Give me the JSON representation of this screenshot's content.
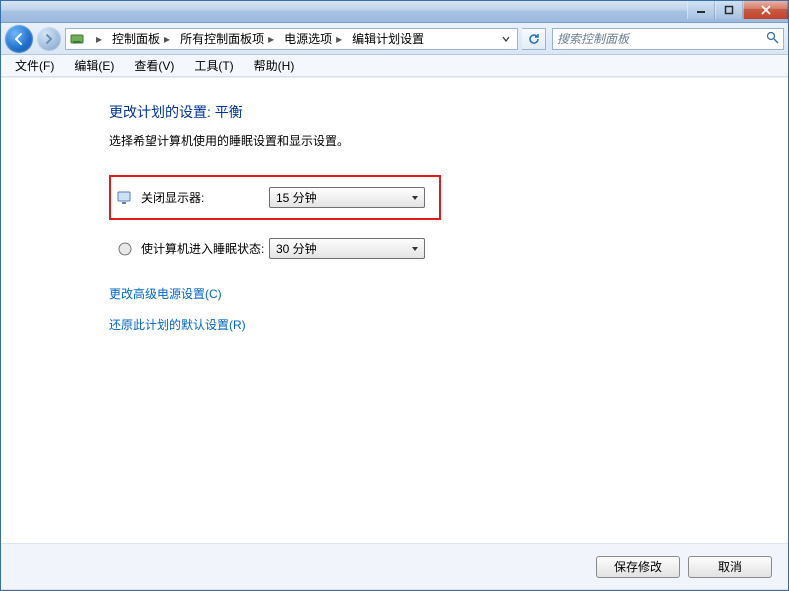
{
  "window_controls": {
    "minimize_label": "minimize",
    "maximize_label": "maximize",
    "close_label": "close"
  },
  "breadcrumb": {
    "items": [
      "控制面板",
      "所有控制面板项",
      "电源选项",
      "编辑计划设置"
    ]
  },
  "search": {
    "placeholder": "搜索控制面板"
  },
  "menu": {
    "file": "文件(F)",
    "edit": "编辑(E)",
    "view": "查看(V)",
    "tools": "工具(T)",
    "help": "帮助(H)"
  },
  "page": {
    "title": "更改计划的设置: 平衡",
    "description": "选择希望计算机使用的睡眠设置和显示设置。",
    "turn_off_display_label": "关闭显示器:",
    "turn_off_display_value": "15 分钟",
    "sleep_label": "使计算机进入睡眠状态:",
    "sleep_value": "30 分钟",
    "advanced_link": "更改高级电源设置(C)",
    "restore_link": "还原此计划的默认设置(R)"
  },
  "footer": {
    "save": "保存修改",
    "cancel": "取消"
  }
}
